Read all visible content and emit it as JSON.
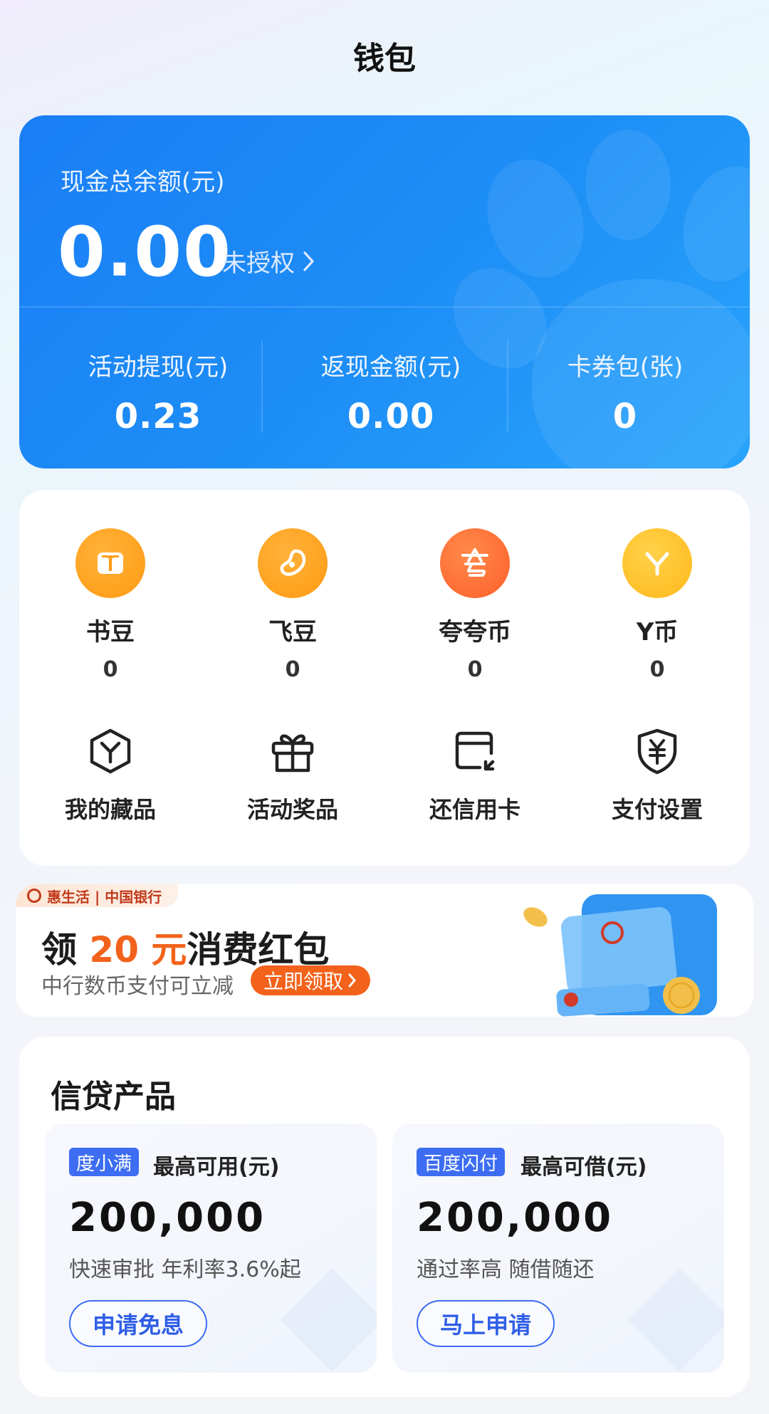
{
  "header": {
    "title": "钱包"
  },
  "wallet": {
    "balance_label": "现金总余额(元)",
    "balance": "0.00",
    "auth_status": "未授权",
    "stats": [
      {
        "label": "活动提现(元)",
        "value": "0.23"
      },
      {
        "label": "返现金额(元)",
        "value": "0.00"
      },
      {
        "label": "卡券包(张)",
        "value": "0"
      }
    ]
  },
  "points": [
    {
      "label": "书豆",
      "value": "0",
      "icon": "book-icon",
      "color": "#ff9a12"
    },
    {
      "label": "飞豆",
      "value": "0",
      "icon": "bean-icon",
      "color": "#ff9a12"
    },
    {
      "label": "夸夸币",
      "value": "0",
      "icon": "kuakua-icon",
      "color": "#ff6a2a"
    },
    {
      "label": "Y币",
      "value": "0",
      "icon": "yuan-y-icon",
      "color": "#ffc020"
    }
  ],
  "services": [
    {
      "label": "我的藏品",
      "icon": "collection-cube-icon"
    },
    {
      "label": "活动奖品",
      "icon": "gift-icon"
    },
    {
      "label": "还信用卡",
      "icon": "credit-card-icon"
    },
    {
      "label": "支付设置",
      "icon": "yen-shield-icon"
    }
  ],
  "banner": {
    "tag": "惠生活 | 中国银行",
    "title_prefix": "领 ",
    "title_highlight": "20 元",
    "title_suffix": "消费红包",
    "subtitle": "中行数币支付可立减",
    "button": "立即领取"
  },
  "credit": {
    "title": "信贷产品",
    "products": [
      {
        "brand": "度小满",
        "head": "最高可用(元)",
        "amount": "200,000",
        "desc": "快速审批 年利率3.6%起",
        "button": "申请免息"
      },
      {
        "brand": "百度闪付",
        "head": "最高可借(元)",
        "amount": "200,000",
        "desc": "通过率高 随借随还",
        "button": "马上申请"
      }
    ]
  },
  "colors": {
    "primary_blue": "#1e8ff7",
    "accent_orange": "#f2621a",
    "brand_blue": "#3d6df2"
  }
}
